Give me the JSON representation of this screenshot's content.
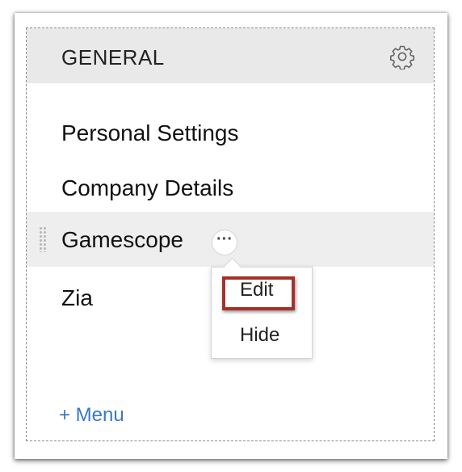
{
  "panel": {
    "title": "GENERAL"
  },
  "menu": {
    "items": [
      {
        "label": "Personal Settings"
      },
      {
        "label": "Company Details"
      },
      {
        "label": "Gamescope"
      },
      {
        "label": "Zia"
      }
    ],
    "more_label": "···",
    "add_label": "+ Menu"
  },
  "popup": {
    "items": [
      {
        "label": "Edit"
      },
      {
        "label": "Hide"
      }
    ]
  },
  "colors": {
    "header_bg": "#e9e9e9",
    "active_row_bg": "#eeeeee",
    "link": "#3a78c4",
    "highlight": "#a4322a"
  },
  "icons": {
    "settings": "gear-icon",
    "more": "more-dots-icon",
    "drag": "drag-handle-icon"
  }
}
